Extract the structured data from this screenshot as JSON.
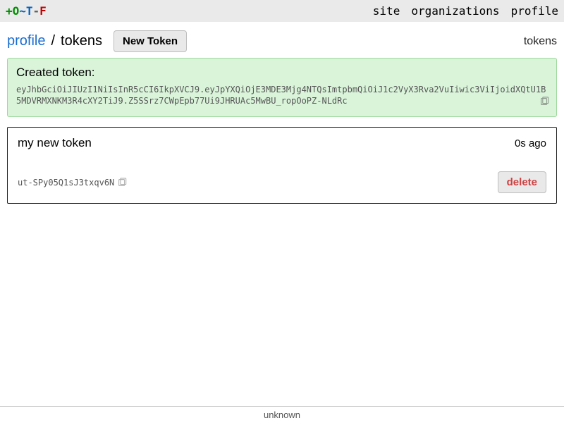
{
  "logo": {
    "p1": "+O",
    "p2": "~T",
    "p3": "-",
    "p4": "F"
  },
  "nav": {
    "site": "site",
    "orgs": "organizations",
    "profile": "profile"
  },
  "breadcrumb": {
    "profile": "profile",
    "sep": " / ",
    "current": "tokens"
  },
  "buttons": {
    "new_token": "New Token",
    "delete": "delete"
  },
  "page_tag": "tokens",
  "alert": {
    "title": "Created token:",
    "token": "eyJhbGciOiJIUzI1NiIsInR5cCI6IkpXVCJ9.eyJpYXQiOjE3MDE3Mjg4NTQsImtpbmQiOiJ1c2VyX3Rva2VuIiwic3ViIjoidXQtU1B5MDVRMXNKM3R4cXY2TiJ9.Z5SSrz7CWpEpb77Ui9JHRUAc5MwBU_ropOoPZ-NLdRc"
  },
  "token_card": {
    "name": "my new token",
    "time": "0s ago",
    "id": "ut-SPy05Q1sJ3txqv6N"
  },
  "footer": "unknown"
}
